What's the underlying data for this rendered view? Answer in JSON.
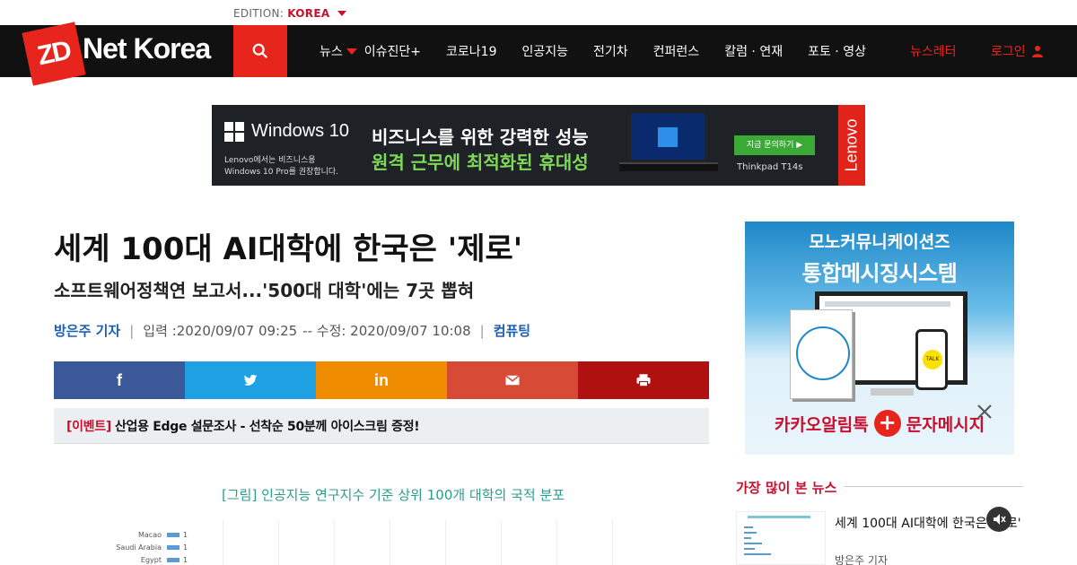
{
  "edition": {
    "label": "EDITION:",
    "value": "KOREA"
  },
  "header": {
    "logo": {
      "zd": "ZD",
      "rest": "Net Korea"
    },
    "menu": [
      {
        "label": "뉴스"
      },
      {
        "label": "이슈진단+"
      },
      {
        "label": "코로나19"
      },
      {
        "label": "인공지능"
      },
      {
        "label": "전기차"
      },
      {
        "label": "컨퍼런스"
      },
      {
        "label": "칼럼 · 연재"
      },
      {
        "label": "포토 · 영상"
      }
    ],
    "newsletter": "뉴스레터",
    "login": "로그인"
  },
  "banner_ad": {
    "brand": "Windows 10",
    "sub1": "Lenovo에서는 비즈니스용",
    "sub2": "Windows 10 Pro를 권장합니다.",
    "headline1": "비즈니스를 위한 강력한 성능",
    "headline2": "원격 근무에 최적화된 휴대성",
    "cta": "지금 문의하기 ▶",
    "model": "Thinkpad T14s",
    "vendor": "Lenovo"
  },
  "article": {
    "headline": "세계 100대 AI대학에 한국은 '제로'",
    "subhead": "소프트웨어정책연 보고서...'500대 대학'에는 7곳 뽑혀",
    "author": "방은주 기자",
    "published": "입력 :2020/09/07 09:25",
    "updated": "-- 수정: 2020/09/07 10:08",
    "category": "컴퓨팅",
    "share": {
      "facebook": "f",
      "linkedin": "in"
    },
    "event_tag": "[이벤트]",
    "event_text": "산업용 Edge 설문조사 - 선착순 50분께 아이스크림 증정!",
    "figure_title": "[그림] 인공지능 연구지수 기준 상위 100개 대학의 국적 분포",
    "figure_rows": [
      {
        "country": "Macao",
        "value": "1"
      },
      {
        "country": "Saudi Arabia",
        "value": "1"
      },
      {
        "country": "Egypt",
        "value": "1"
      }
    ]
  },
  "side_ad": {
    "line1": "모노커뮤니케이션즈",
    "line2": "통합메시징시스템",
    "bottom_left": "카카오알림톡",
    "plus": "+",
    "bottom_right": "문자메시지"
  },
  "most_viewed": {
    "heading": "가장 많이 본 뉴스",
    "items": [
      {
        "title": "세계 100대 AI대학에 한국은 '제로'",
        "author": "방은주 기자"
      }
    ]
  }
}
